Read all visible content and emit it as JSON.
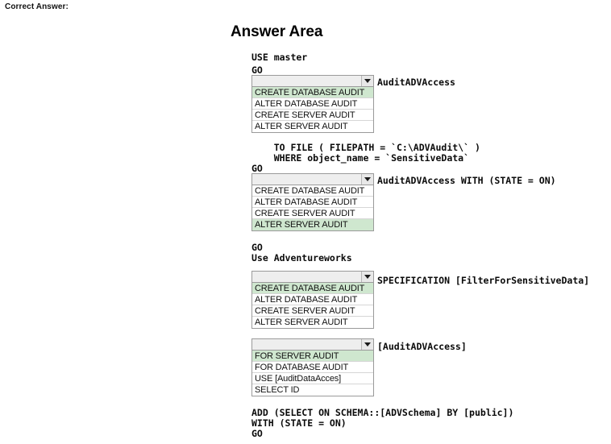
{
  "page": {
    "correct_answer_label": "Correct Answer:",
    "answer_area_title": "Answer Area"
  },
  "colors": {
    "selected_option_bg": "#cfe7cf",
    "combo_bg": "#eeeeee",
    "border": "#9a9a9a",
    "text": "#0a0a0a"
  },
  "code": {
    "line1": "USE master",
    "line2": "GO",
    "line3": "    TO FILE ( FILEPATH = `C:\\ADVAudit\\` )",
    "line4": "    WHERE object_name = `SensitiveData`",
    "line5": "GO",
    "line6": "GO",
    "line7": "Use Adventureworks",
    "line8": "ADD (SELECT ON SCHEMA::[ADVSchema] BY [public])",
    "line9": "WITH (STATE = ON)",
    "line10": "GO"
  },
  "dropdowns": [
    {
      "id": "dropdown-1",
      "value": "",
      "trailing_text": "AuditADVAccess",
      "options": [
        "CREATE DATABASE AUDIT",
        "ALTER DATABASE AUDIT",
        "CREATE SERVER AUDIT",
        "ALTER SERVER AUDIT"
      ],
      "selected_index": 2
    },
    {
      "id": "dropdown-2",
      "value": "",
      "trailing_text": "AuditADVAccess WITH (STATE = ON)",
      "options": [
        "CREATE DATABASE AUDIT",
        "ALTER DATABASE AUDIT",
        "CREATE SERVER AUDIT",
        "ALTER SERVER AUDIT"
      ],
      "selected_index": 3
    },
    {
      "id": "dropdown-3",
      "value": "",
      "trailing_text": "SPECIFICATION [FilterForSensitiveData]",
      "options": [
        "CREATE DATABASE AUDIT",
        "ALTER DATABASE AUDIT",
        "CREATE SERVER AUDIT",
        "ALTER SERVER AUDIT"
      ],
      "selected_index": 0
    },
    {
      "id": "dropdown-4",
      "value": "",
      "trailing_text": "[AuditADVAccess]",
      "options": [
        "FOR SERVER AUDIT",
        "FOR DATABASE AUDIT",
        "USE [AuditDataAcces]",
        "SELECT ID"
      ],
      "selected_index": 0
    }
  ]
}
